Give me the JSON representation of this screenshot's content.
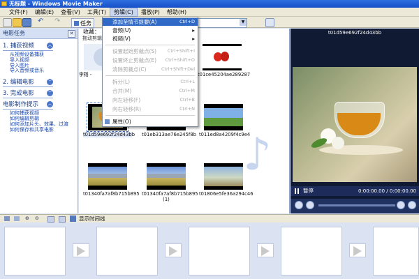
{
  "window": {
    "title": "无标题 - Windows Movie Maker"
  },
  "menubar": {
    "items": [
      "文件(F)",
      "编辑(E)",
      "查看(V)",
      "工具(T)",
      "剪辑(C)",
      "播放(P)",
      "帮助(H)"
    ]
  },
  "toolbar": {
    "tasks_label": "任务",
    "undo_label": "↶",
    "redo_label": "↷"
  },
  "taskpane": {
    "header": "电影任务",
    "sections": [
      {
        "label": "1. 捕获视频",
        "links": [
          "从视频设备捕获",
          "导入视频",
          "导入图片",
          "导入音频或音乐"
        ]
      },
      {
        "label": "2. 编辑电影",
        "links": []
      },
      {
        "label": "3. 完成电影",
        "links": []
      },
      {
        "label": "电影制作提示",
        "links": [
          "如何捕获视频",
          "如何编辑剪辑",
          "如何添加片头、效果、过渡",
          "如何保存和共享电影"
        ]
      }
    ]
  },
  "collection": {
    "title": "收藏：",
    "subtitle": "拖动剪辑",
    "clips": [
      {
        "label": "李翔 -"
      },
      {
        "label": "t01ce45204ae289287"
      },
      {
        "label": "t01d59e692f24d43bb"
      },
      {
        "label": "t01eb313ae76e245f8b"
      },
      {
        "label": "t011ed8a4209f4c9e4"
      },
      {
        "label": "t01340fa7af8b715b895"
      },
      {
        "label": "t01340fa7af8b715b895 (1)"
      },
      {
        "label": "t01806e5fe36a294c46"
      }
    ]
  },
  "clip_menu": {
    "items": [
      {
        "label": "添加至情节提要(A)",
        "shortcut": "Ctrl+D",
        "state": "highlighted"
      },
      {
        "label": "音频(U)",
        "submenu": true,
        "state": "enabled"
      },
      {
        "label": "视频(V)",
        "submenu": true,
        "state": "enabled"
      },
      {
        "label": "设置起始剪裁点(S)",
        "shortcut": "Ctrl+Shift+I",
        "state": "disabled"
      },
      {
        "label": "设置终止剪裁点(E)",
        "shortcut": "Ctrl+Shift+O",
        "state": "disabled"
      },
      {
        "label": "清除剪裁点(C)",
        "shortcut": "Ctrl+Shift+Del",
        "state": "disabled"
      },
      {
        "label": "拆分(L)",
        "shortcut": "Ctrl+L",
        "state": "disabled"
      },
      {
        "label": "合并(M)",
        "shortcut": "Ctrl+M",
        "state": "disabled"
      },
      {
        "label": "向左轻移(F)",
        "shortcut": "Ctrl+B",
        "state": "disabled"
      },
      {
        "label": "向右轻移(R)",
        "shortcut": "Ctrl+N",
        "state": "disabled"
      },
      {
        "label": "属性(O)",
        "state": "enabled"
      }
    ]
  },
  "monitor": {
    "title": "t01d59e692f24d43bb",
    "status": "暂停",
    "time": "0:00:00.00 / 0:00:00.00"
  },
  "storyboard": {
    "show_timeline_label": "显示时间线"
  },
  "colors": {
    "titlebar": "#1550c8",
    "highlight": "#3169c6",
    "monitor_bg": "#111a33"
  }
}
